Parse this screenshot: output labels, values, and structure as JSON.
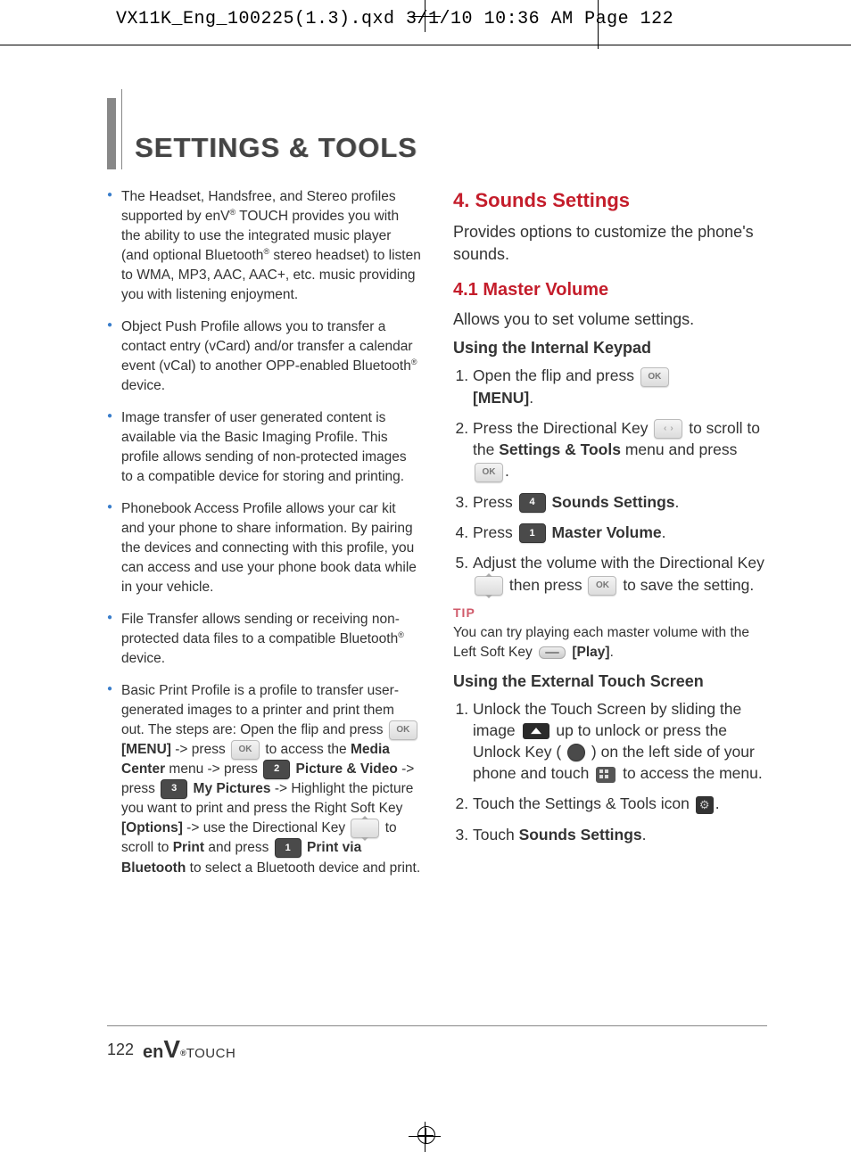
{
  "meta": {
    "crop_header": "VX11K_Eng_100225(1.3).qxd  3/1/10  10:36 AM  Page 122"
  },
  "title": "SETTINGS & TOOLS",
  "left_column": {
    "bullets": [
      {
        "pre": "The Headset, Handsfree, and Stereo profiles supported by enV",
        "reg1": "®",
        "mid": " TOUCH provides you with the ability to use the integrated music player (and optional Bluetooth",
        "reg2": "®",
        "post": " stereo headset) to listen to WMA, MP3, AAC, AAC+, etc. music providing you with listening enjoyment."
      },
      {
        "pre": "Object Push Profile allows you to transfer a contact entry (vCard) and/or transfer a calendar event (vCal) to another OPP-enabled Bluetooth",
        "reg1": "®",
        "post": " device."
      },
      {
        "text": "Image transfer of user generated content is available via the Basic Imaging Profile. This profile allows sending of non-protected images to a compatible device for storing and printing."
      },
      {
        "text": "Phonebook Access Profile allows your car kit and your phone to share information. By pairing the devices and connecting with this profile, you can access and use your phone book data while in your vehicle."
      },
      {
        "pre": "File Transfer allows sending or receiving non-protected data files to a compatible Bluetooth",
        "reg1": "®",
        "post": " device."
      },
      {
        "seg1": "Basic Print Profile is a profile to transfer user-generated images to a printer and print them out. The steps are: Open the flip and press ",
        "menu": "[MENU]",
        "seg2": " -> press ",
        "seg3": " to access the ",
        "media": "Media Center",
        "seg4": " menu -> press ",
        "key2": "2",
        "picvid": "Picture & Video",
        "seg5": " -> press ",
        "key3": "3",
        "mypics": "My Pictures",
        "seg6": " -> Highlight the picture you want to print and press the Right Soft Key ",
        "options": "[Options]",
        "seg7": " -> use the Directional Key ",
        "seg8": " to scroll to ",
        "print": "Print",
        "seg9": " and press ",
        "key1": "1",
        "pvb": "Print via Bluetooth",
        "seg10": " to select a Bluetooth device and print."
      }
    ]
  },
  "right_column": {
    "h4": "4. Sounds Settings",
    "h4_body": "Provides options to customize the phone's sounds.",
    "h41": "4.1 Master Volume",
    "h41_body": "Allows you to set volume settings.",
    "internal_h": "Using the Internal Keypad",
    "steps_internal": {
      "s1a": "Open the flip and press ",
      "s1b": "[MENU]",
      "s1c": ".",
      "s2a": "Press the Directional Key ",
      "s2b": " to scroll to the ",
      "s2c": "Settings & Tools",
      "s2d": " menu and press ",
      "s2e": ".",
      "s3a": "Press ",
      "s3k": "4",
      "s3b": "Sounds Settings",
      "s3c": ".",
      "s4a": "Press ",
      "s4k": "1",
      "s4b": "Master Volume",
      "s4c": ".",
      "s5a": "Adjust the volume with the Directional Key ",
      "s5b": " then press ",
      "s5c": " to save the setting."
    },
    "tip_label": "TIP",
    "tip_a": "You can try playing each master volume with the Left Soft Key ",
    "tip_b": "[Play]",
    "tip_c": ".",
    "external_h": "Using the External Touch Screen",
    "steps_external": {
      "s1a": "Unlock the Touch Screen by sliding the image ",
      "s1b": " up to unlock or press the Unlock Key ( ",
      "s1c": " ) on the left side of your phone and touch ",
      "s1d": " to access the menu.",
      "s2a": "Touch the Settings & Tools icon ",
      "s2b": ".",
      "s3a": "Touch ",
      "s3b": "Sounds Settings",
      "s3c": "."
    }
  },
  "footer": {
    "page": "122",
    "brand_en": "en",
    "brand_v": "V",
    "brand_reg": "®",
    "brand_touch": "TOUCH"
  },
  "icons": {
    "ok": "OK",
    "key2": "2",
    "key3": "3",
    "key1": "1",
    "key4": "4"
  }
}
